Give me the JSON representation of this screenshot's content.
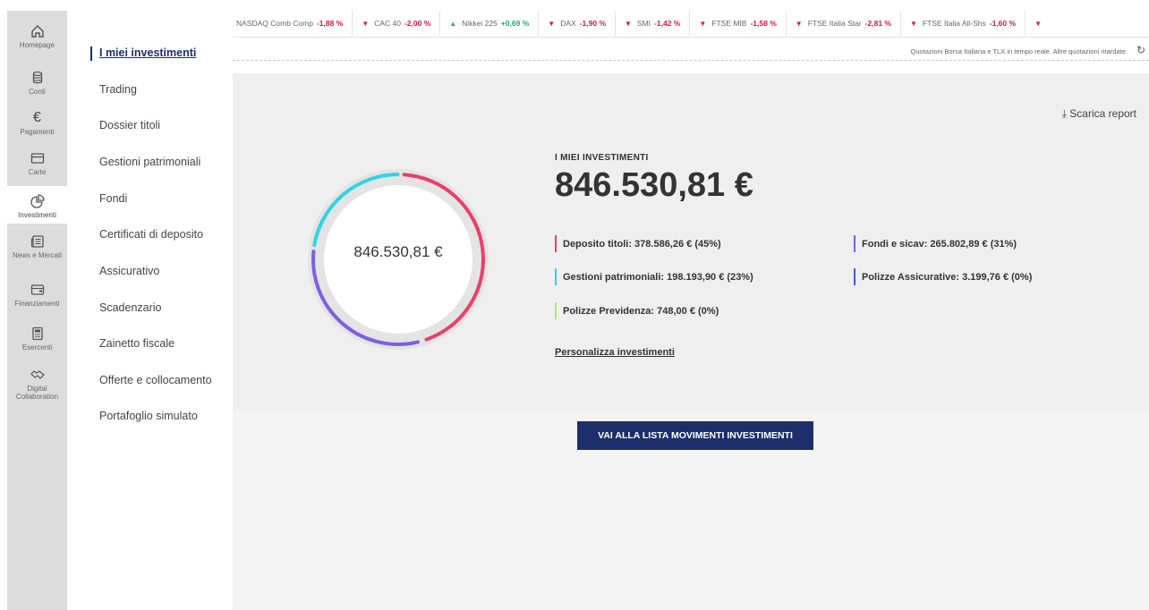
{
  "rail": {
    "items": [
      {
        "label": "Homepage",
        "icon": "home-icon"
      },
      {
        "label": "Conti",
        "icon": "coins-icon"
      },
      {
        "label": "Pagamenti",
        "icon": "euro-icon"
      },
      {
        "label": "Carte",
        "icon": "card-icon"
      },
      {
        "label": "Investimenti",
        "icon": "pie-chart-icon",
        "active": true
      },
      {
        "label": "News e Mercati",
        "icon": "news-icon"
      },
      {
        "label": "Finanziamenti",
        "icon": "wallet-icon"
      },
      {
        "label": "Esercenti",
        "icon": "pos-terminal-icon"
      },
      {
        "label": "Digital Collaboration",
        "icon": "handshake-icon"
      }
    ]
  },
  "menu": {
    "items": [
      {
        "label": "I miei investimenti",
        "active": true
      },
      {
        "label": "Trading"
      },
      {
        "label": "Dossier titoli"
      },
      {
        "label": "Gestioni patrimoniali"
      },
      {
        "label": "Fondi"
      },
      {
        "label": "Certificati di deposito"
      },
      {
        "label": "Assicurativo"
      },
      {
        "label": "Scadenzario"
      },
      {
        "label": "Zainetto fiscale"
      },
      {
        "label": "Offerte e collocamento"
      },
      {
        "label": "Portafoglio simulato"
      }
    ]
  },
  "ticker": {
    "items": [
      {
        "name": "NASDAQ Comb Comp",
        "value": "-1,88 %",
        "direction": "none"
      },
      {
        "name": "CAC 40",
        "value": "-2,00 %",
        "direction": "down"
      },
      {
        "name": "Nikkei 225",
        "value": "+0,69 %",
        "direction": "up"
      },
      {
        "name": "DAX",
        "value": "-1,90 %",
        "direction": "down"
      },
      {
        "name": "SMI",
        "value": "-1,42 %",
        "direction": "down"
      },
      {
        "name": "FTSE MIB",
        "value": "-1,58 %",
        "direction": "down"
      },
      {
        "name": "FTSE Italia Star",
        "value": "-2,81 %",
        "direction": "down"
      },
      {
        "name": "FTSE Italia All-Shs",
        "value": "-1,60 %",
        "direction": "down"
      }
    ],
    "note": "Quotazioni Borsa Italiana e TLX in tempo reale. Altre quotazioni ritardate."
  },
  "report": {
    "download_label": "Scarica report"
  },
  "summary": {
    "label": "I MIEI INVESTIMENTI",
    "total": "846.530,81 €",
    "donut_total": "846.530,81 €"
  },
  "allocations": [
    {
      "text": "Deposito titoli: 378.586,26 € (45%)",
      "color": "#e8416a",
      "share": 0.4472
    },
    {
      "text": "Fondi e sicav: 265.802,89 € (31%)",
      "color": "#7b61e0",
      "share": 0.314
    },
    {
      "text": "Gestioni patrimoniali: 198.193,90 € (23%)",
      "color": "#2fd4e6",
      "share": 0.2341
    },
    {
      "text": "Polizze Assicurative: 3.199,76 € (0%)",
      "color": "#3d5af1",
      "share": 0.0038
    },
    {
      "text": "Polizze Previdenza: 748,00 € (0%)",
      "color": "#b6e36a",
      "share": 0.0009
    }
  ],
  "personalize_label": "Personalizza investimenti",
  "cta_label": "VAI ALLA LISTA MOVIMENTI INVESTIMENTI"
}
